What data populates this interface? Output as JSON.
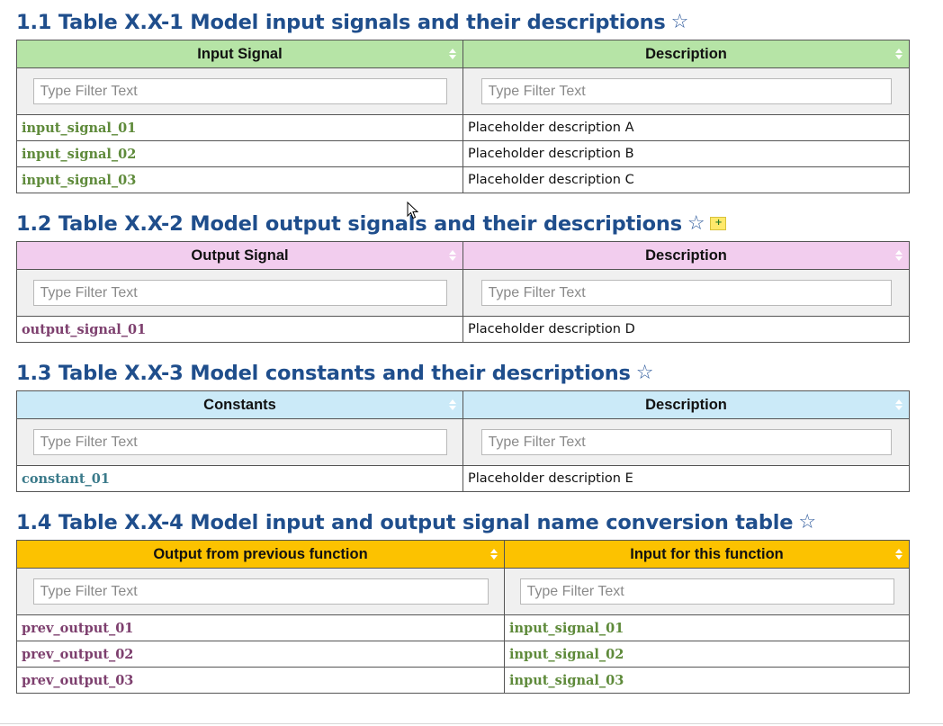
{
  "filter_placeholder": "Type Filter Text",
  "colors": {
    "heading": "#1f4e8c",
    "input_header_bg": "#b6e4a6",
    "input_signal_text": "#5e8a3a",
    "output_header_bg": "#f2cdee",
    "output_signal_text": "#7d3f6e",
    "constants_header_bg": "#cbeaf8",
    "constant_text": "#3a7a8a",
    "conversion_header_bg": "#fcc200"
  },
  "tables": [
    {
      "heading": "1.1 Table X.X-1 Model input signals and their descriptions",
      "columns": [
        "Input Signal",
        "Description"
      ],
      "rows": [
        [
          "input_signal_01",
          "Placeholder description A"
        ],
        [
          "input_signal_02",
          "Placeholder description B"
        ],
        [
          "input_signal_03",
          "Placeholder description C"
        ]
      ]
    },
    {
      "heading": "1.2 Table X.X-2 Model output signals and their descriptions",
      "columns": [
        "Output Signal",
        "Description"
      ],
      "rows": [
        [
          "output_signal_01",
          "Placeholder description D"
        ]
      ]
    },
    {
      "heading": "1.3 Table X.X-3 Model constants and their descriptions",
      "columns": [
        "Constants",
        "Description"
      ],
      "rows": [
        [
          "constant_01",
          "Placeholder description E"
        ]
      ]
    },
    {
      "heading": "1.4 Table X.X-4 Model input and output signal name conversion table",
      "columns": [
        "Output from previous function",
        "Input for this function"
      ],
      "rows": [
        [
          "prev_output_01",
          "input_signal_01"
        ],
        [
          "prev_output_02",
          "input_signal_02"
        ],
        [
          "prev_output_03",
          "input_signal_03"
        ]
      ]
    }
  ],
  "icons": {
    "favorite": "star-outline-icon",
    "note": "sticky-note-icon",
    "sort": "sort-arrows-icon",
    "cursor": "mouse-pointer-icon"
  }
}
